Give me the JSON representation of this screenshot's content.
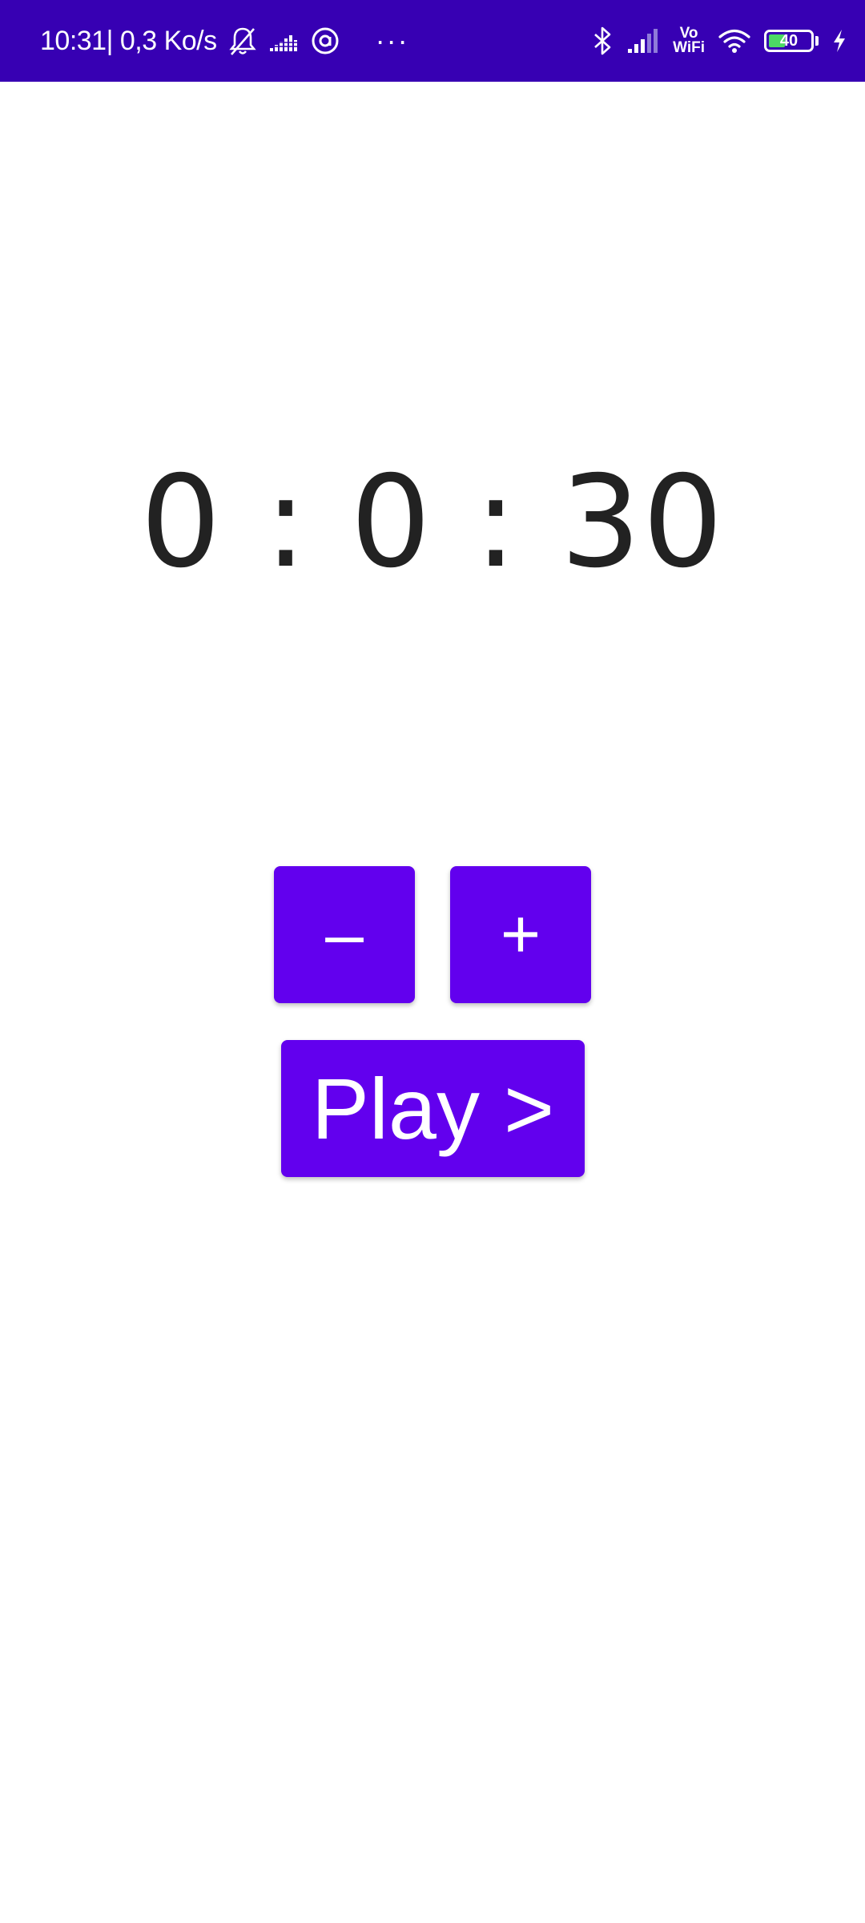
{
  "status_bar": {
    "time": "10:31",
    "network_speed": "| 0,3 Ko/s",
    "more_dots": "···",
    "vowifi_top": "Vo",
    "vowifi_bottom": "WiFi",
    "battery_level": "40",
    "battery_fraction": 0.4,
    "background_color": "#3700b3",
    "icons_left": [
      "bell-off-icon",
      "equalizer-icon",
      "at-sign-icon"
    ],
    "icons_right": [
      "bluetooth-icon",
      "signal-icon",
      "vowifi-icon",
      "wifi-icon",
      "battery-icon",
      "charging-icon"
    ]
  },
  "timer": {
    "display": "0 : 0 : 30"
  },
  "controls": {
    "minus_label": "–",
    "plus_label": "+",
    "play_label": "Play >",
    "button_color": "#6200ee"
  }
}
